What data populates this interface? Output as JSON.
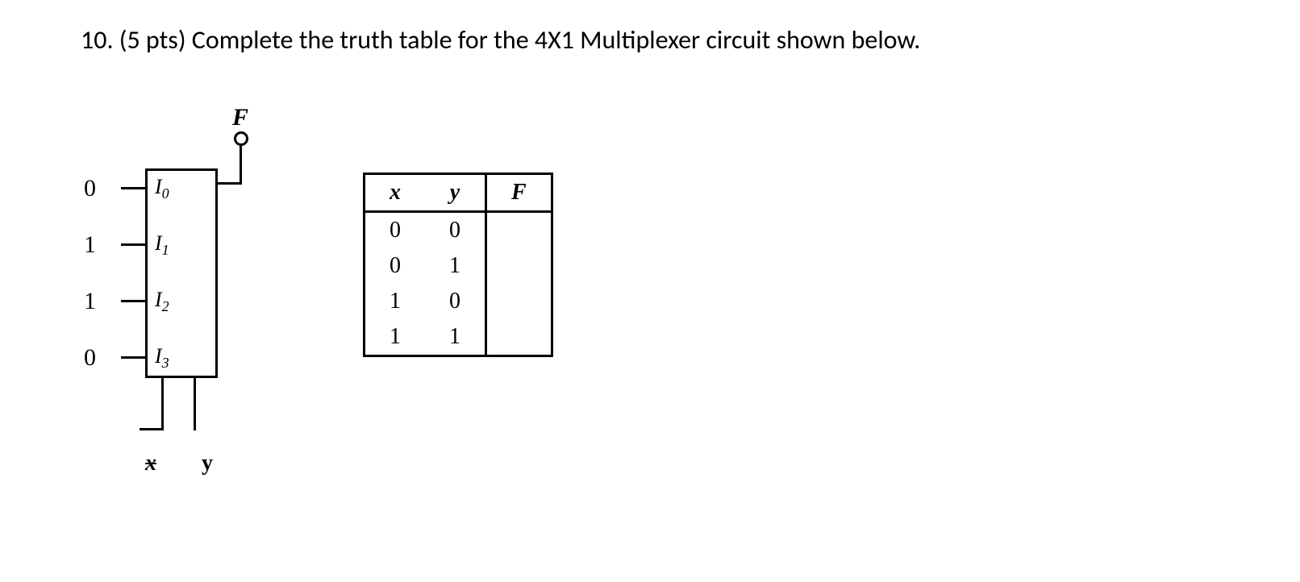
{
  "question": "10. (5 pts) Complete the truth table for the 4X1 Multiplexer circuit shown below.",
  "circuit": {
    "output_label": "F",
    "inputs": [
      {
        "value": "0",
        "label": "I",
        "sub": "0"
      },
      {
        "value": "1",
        "label": "I",
        "sub": "1"
      },
      {
        "value": "1",
        "label": "I",
        "sub": "2"
      },
      {
        "value": "0",
        "label": "I",
        "sub": "3"
      }
    ],
    "selects": [
      {
        "label": "x"
      },
      {
        "label": "y"
      }
    ]
  },
  "table": {
    "headers": {
      "col1": "x",
      "col2": "y",
      "col3": "F"
    },
    "rows": [
      {
        "x": "0",
        "y": "0",
        "f": ""
      },
      {
        "x": "0",
        "y": "1",
        "f": ""
      },
      {
        "x": "1",
        "y": "0",
        "f": ""
      },
      {
        "x": "1",
        "y": "1",
        "f": ""
      }
    ]
  }
}
